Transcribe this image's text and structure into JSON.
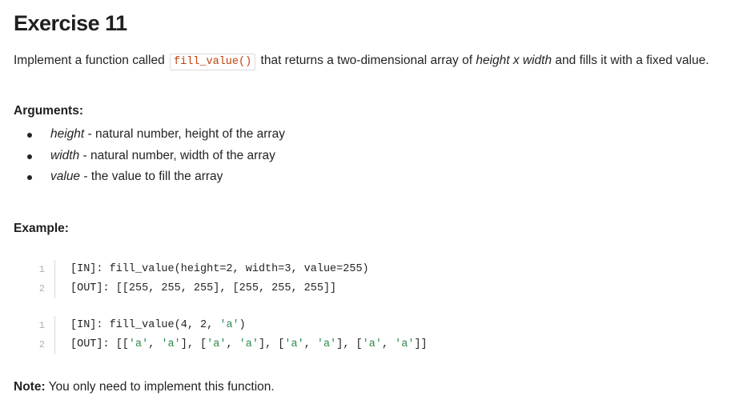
{
  "title": "Exercise 11",
  "intro": {
    "before": "Implement a function called ",
    "code": "fill_value()",
    "middle": " that returns a two-dimensional array of ",
    "dims": "height x width",
    "after": " and fills it with a fixed value."
  },
  "arguments": {
    "heading": "Arguments:",
    "items": [
      {
        "name": "height",
        "desc": " - natural number, height of the array"
      },
      {
        "name": "width",
        "desc": " - natural number, width of the array"
      },
      {
        "name": "value",
        "desc": " - the value to fill the array"
      }
    ]
  },
  "example": {
    "heading": "Example:",
    "blocks": [
      [
        {
          "num": "1",
          "text": "[IN]: fill_value(height=2, width=3, value=255)"
        },
        {
          "num": "2",
          "text": "[OUT]: [[255, 255, 255], [255, 255, 255]]"
        }
      ],
      [
        {
          "num": "1",
          "text": "[IN]: fill_value(4, 2, 'a')"
        },
        {
          "num": "2",
          "text": "[OUT]: [['a', 'a'], ['a', 'a'], ['a', 'a'], ['a', 'a']]"
        }
      ]
    ]
  },
  "note": {
    "label": "Note:",
    "text": " You only need to implement this function."
  }
}
